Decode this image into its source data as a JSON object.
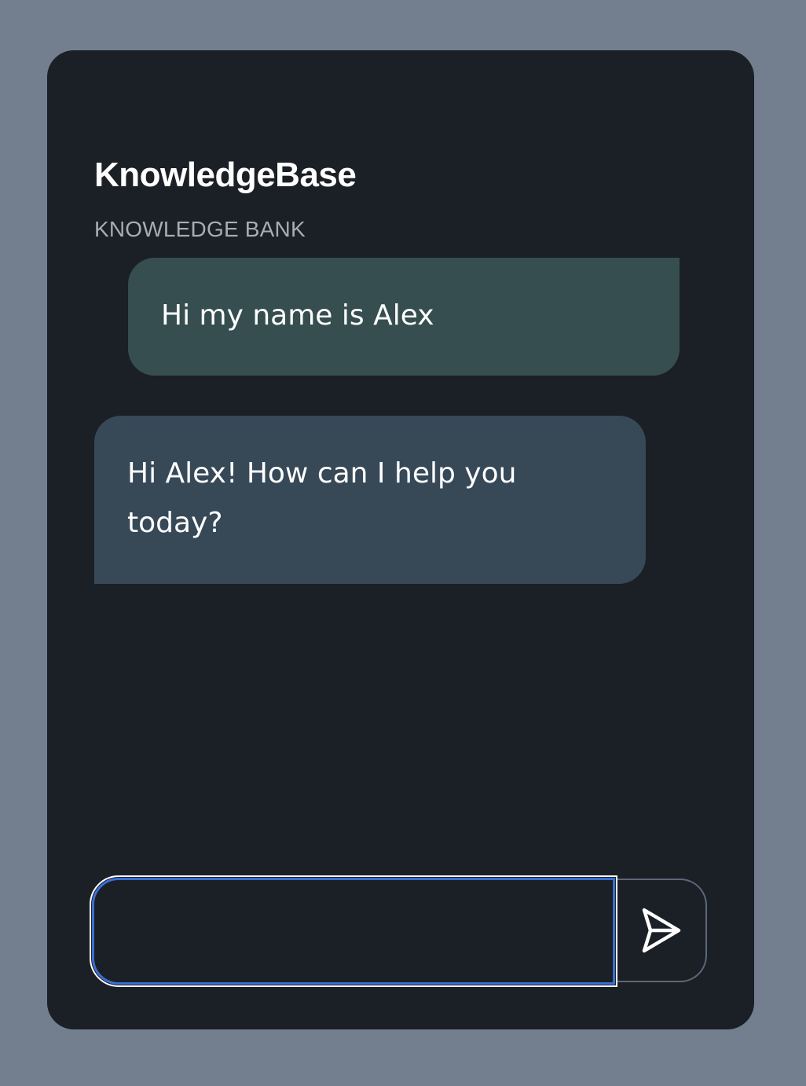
{
  "app": {
    "title": "KnowledgeBase",
    "subtitle": "KNOWLEDGE BANK"
  },
  "messages": [
    {
      "role": "user",
      "text": "Hi my name is Alex"
    },
    {
      "role": "assistant",
      "text": "Hi Alex! How can I help you today?"
    }
  ],
  "composer": {
    "value": "",
    "placeholder": "",
    "send_icon": "send-icon"
  },
  "colors": {
    "page_background": "#737f8f",
    "panel_background": "#1b1f26",
    "user_bubble": "#364e50",
    "assistant_bubble": "#374857",
    "input_focus_border": "#3a6fd3"
  }
}
